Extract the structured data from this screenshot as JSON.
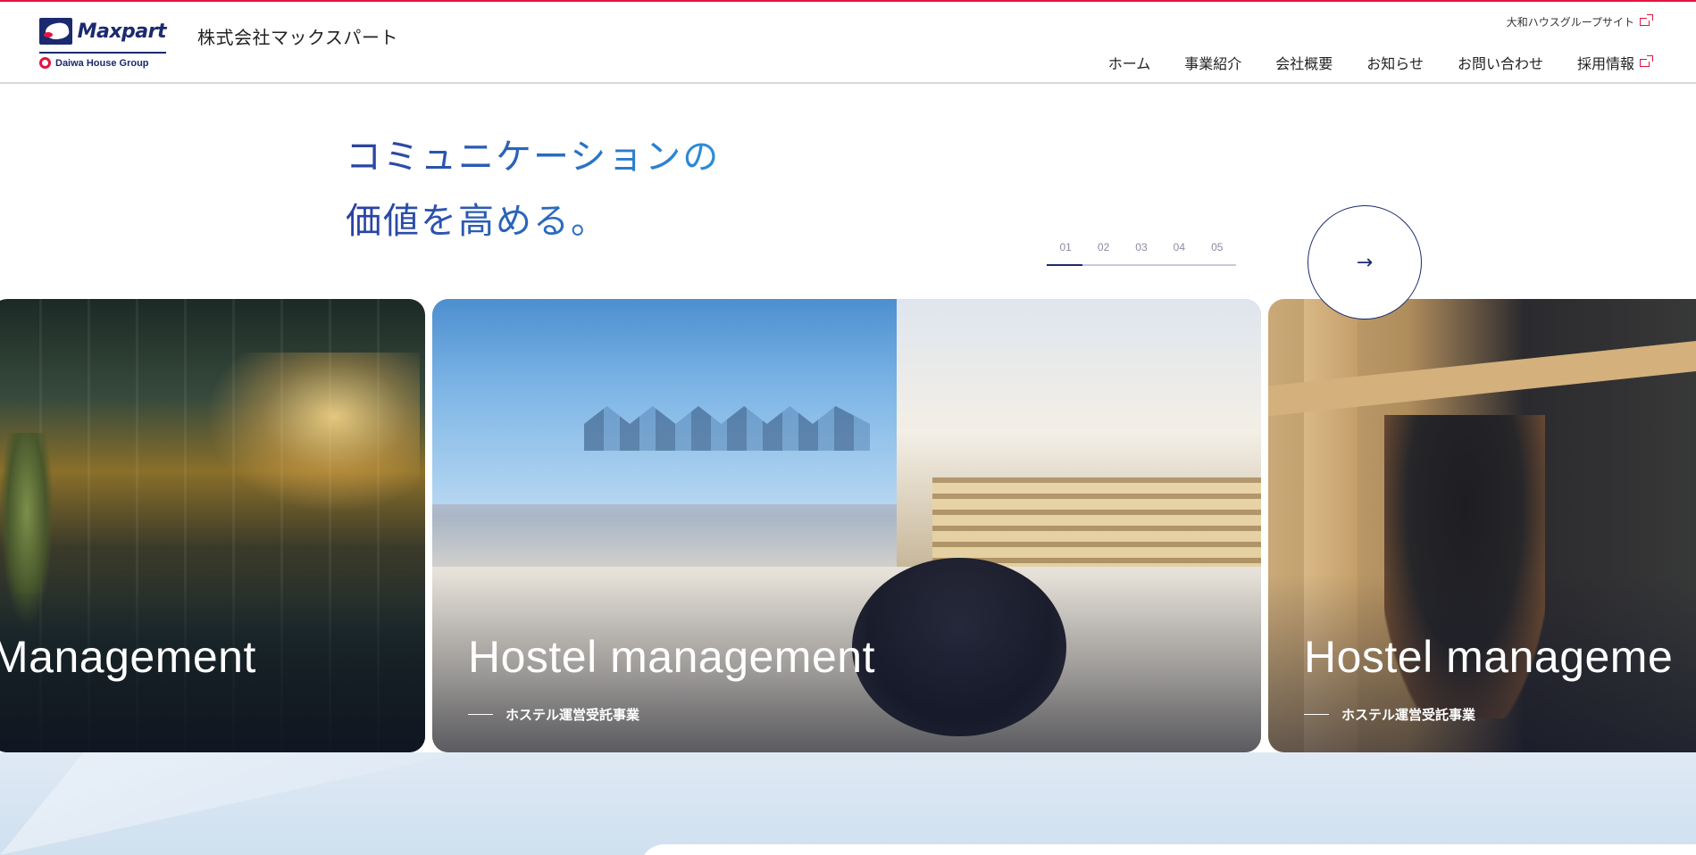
{
  "header": {
    "logo_word": "Maxpart",
    "logo_group": "Daiwa House Group",
    "company_name": "株式会社マックスパート",
    "util_link": "大和ハウスグループサイト",
    "nav": [
      {
        "label": "ホーム"
      },
      {
        "label": "事業紹介"
      },
      {
        "label": "会社概要"
      },
      {
        "label": "お知らせ"
      },
      {
        "label": "お問い合わせ"
      },
      {
        "label": "採用情報"
      }
    ]
  },
  "hero": {
    "tagline_line1": "コミュニケーションの",
    "tagline_line2": "価値を高める。"
  },
  "pager": {
    "items": [
      "01",
      "02",
      "03",
      "04",
      "05"
    ],
    "active": "01"
  },
  "slides": [
    {
      "title": "l Management",
      "subtitle": ""
    },
    {
      "title": "Hostel management",
      "subtitle": "ホステル運営受託事業"
    },
    {
      "title": "Hostel manageme",
      "subtitle": "ホステル運営受託事業"
    }
  ],
  "icons": {
    "next": "arrow-right-icon",
    "external": "external-link-icon"
  },
  "colors": {
    "accent_red": "#e4123f",
    "brand_navy": "#1b2a6e",
    "tagline_gradient_start": "#2a3fa0",
    "tagline_gradient_end": "#2d8fd8"
  }
}
